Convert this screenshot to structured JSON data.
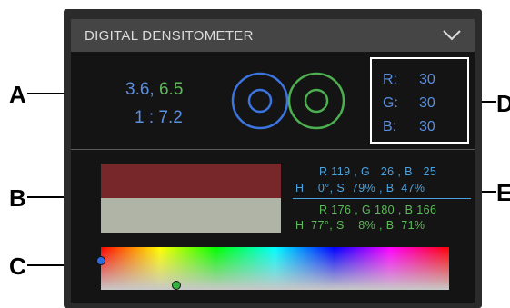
{
  "callouts": {
    "a": "A",
    "b": "B",
    "c": "C",
    "d": "D",
    "e": "E"
  },
  "header": {
    "title": "DIGITAL DENSITOMETER",
    "collapse_icon": "chevron-down-icon"
  },
  "density": {
    "value_1": "3.6,",
    "value_2": "6.5",
    "ratio": "1 : 7.2"
  },
  "rgb": {
    "r_label": "R:",
    "r_value": "30",
    "g_label": "G:",
    "g_value": "30",
    "b_label": "B:",
    "b_value": "30"
  },
  "sample_1": {
    "rgb": "R 119 , G   26 , B   25",
    "hsb": "H    0°, S  79% , B  47%"
  },
  "sample_2": {
    "rgb": "R 176 , G 180 , B 166",
    "hsb": "H  77°, S    8% , B  71%"
  },
  "colors": {
    "swatch_1": "#77262a",
    "swatch_2": "#b0b4a6",
    "blue": "#5b8fe0",
    "green": "#5dbb57",
    "info_blue": "#4aa3df"
  },
  "icons": {
    "circles": "concentric-circles-icon",
    "marker_1": "blue-marker-icon",
    "marker_2": "green-marker-icon"
  }
}
